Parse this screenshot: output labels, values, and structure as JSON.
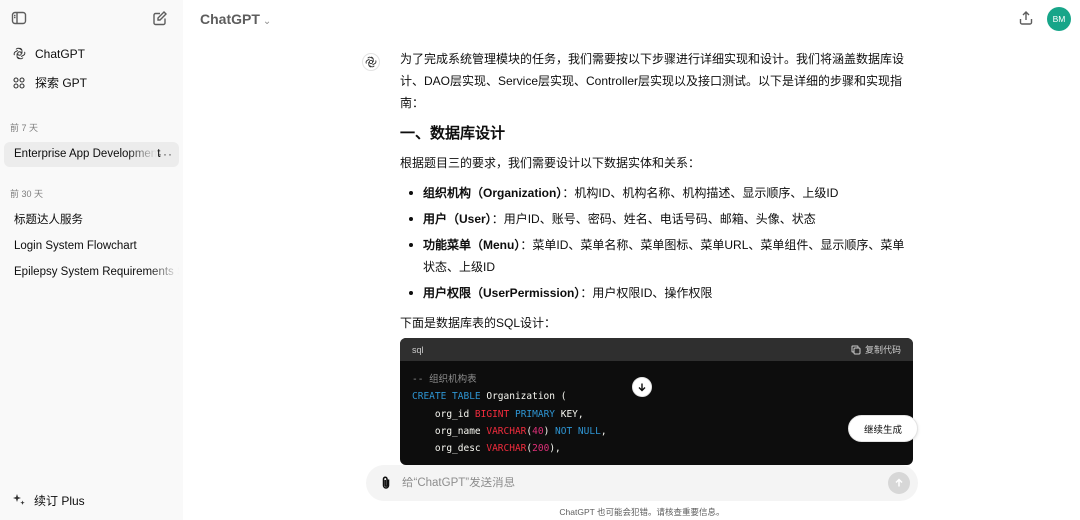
{
  "sidebar": {
    "nav": [
      {
        "label": "ChatGPT",
        "icon": "openai-logo-icon"
      },
      {
        "label": "探索 GPT",
        "icon": "grid-icon"
      }
    ],
    "sections": [
      {
        "title": "前 7 天",
        "items": [
          "Enterprise App Development"
        ]
      },
      {
        "title": "前 30 天",
        "items": [
          "标题达人服务",
          "Login System Flowchart",
          "Epilepsy System Requirements S"
        ]
      }
    ],
    "upgrade_label": "续订 Plus"
  },
  "header": {
    "model_title": "ChatGPT",
    "avatar_initials": "BM",
    "avatar_color": "#17a589"
  },
  "message": {
    "intro": "为了完成系统管理模块的任务，我们需要按以下步骤进行详细实现和设计。我们将涵盖数据库设计、DAO层实现、Service层实现、Controller层实现以及接口测试。以下是详细的步骤和实现指南：",
    "heading": "一、数据库设计",
    "para1": "根据题目三的要求，我们需要设计以下数据实体和关系：",
    "bullets": [
      {
        "term": "组织机构（Organization）",
        "sep": "：",
        "desc": "机构ID、机构名称、机构描述、显示顺序、上级ID"
      },
      {
        "term": "用户（User）",
        "sep": "：",
        "desc": "用户ID、账号、密码、姓名、电话号码、邮箱、头像、状态"
      },
      {
        "term": "功能菜单（Menu）",
        "sep": "：",
        "desc": "菜单ID、菜单名称、菜单图标、菜单URL、菜单组件、显示顺序、菜单状态、上级ID"
      },
      {
        "term": "用户权限（UserPermission）",
        "sep": "：",
        "desc": "用户权限ID、操作权限"
      }
    ],
    "para2": "下面是数据库表的SQL设计："
  },
  "code": {
    "language": "sql",
    "copy_label": "复制代码",
    "lines": {
      "comment": "-- 组织机构表",
      "create_kw": "CREATE TABLE",
      "table_name": " Organization (",
      "l2_name": "    org_id ",
      "l2_type": "BIGINT",
      "l2_kw": " PRIMARY",
      "l2_rest": " KEY,",
      "l3_name": "    org_name ",
      "l3_type": "VARCHAR",
      "l3_num": "40",
      "l3_kw": "NOT NULL",
      "l4_name": "    org_desc ",
      "l4_type": "VARCHAR",
      "l4_num": "200"
    }
  },
  "continue_label": "继续生成",
  "composer": {
    "placeholder": "给“ChatGPT”发送消息"
  },
  "disclaimer": "ChatGPT 也可能会犯错。请核查重要信息。"
}
